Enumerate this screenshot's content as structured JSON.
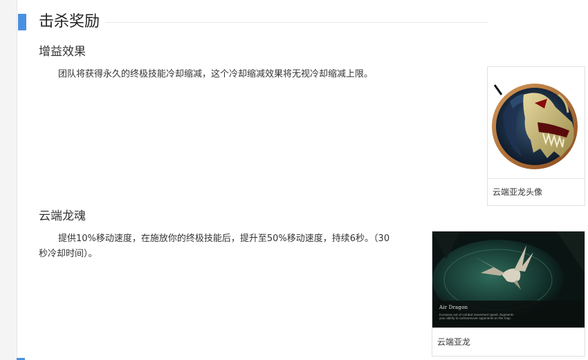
{
  "section": {
    "title": "击杀奖励"
  },
  "buff": {
    "heading": "增益效果",
    "text": "团队将获得永久的终极技能冷却缩减，这个冷却缩减效果将无视冷却缩减上限。",
    "figure": {
      "caption": "云端亚龙头像",
      "icon": "cloud-drake-portrait"
    }
  },
  "soul": {
    "heading": "云端龙魂",
    "text_line1": "提供10%移动速度，在施放你的终极技能后，提升至50%移动速度，持续6秒。（30",
    "text_line2": "秒冷却时间）。",
    "figure": {
      "caption": "云端亚龙",
      "image_title": "Air Dragon",
      "image_desc": "Increases out of combat movement speed. Augments your ability to outmaneuver opponents on the map."
    }
  },
  "colors": {
    "accent": "#4a90e2",
    "portrait_ring": "#b87333"
  }
}
